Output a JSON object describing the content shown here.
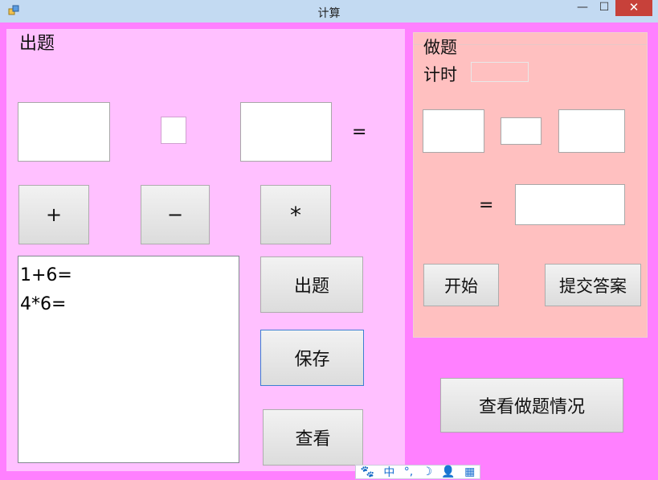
{
  "window": {
    "title": "计算",
    "minimize": "—",
    "maximize": "☐",
    "close": "✕"
  },
  "left": {
    "group_label": "出题",
    "equals": "=",
    "op_plus": "+",
    "op_minus": "−",
    "op_times": "*",
    "list_items": [
      "1+6=",
      "4*6="
    ],
    "btn_generate": "出题",
    "btn_save": "保存",
    "btn_view": "查看"
  },
  "right": {
    "group_label": "做题",
    "timer_label": "计时",
    "equals": "=",
    "btn_start": "开始",
    "btn_submit": "提交答案"
  },
  "btn_view_status": "查看做题情况",
  "ime": {
    "items": [
      "🐾",
      "中",
      "°,",
      "☽",
      "👤",
      "▦"
    ]
  }
}
